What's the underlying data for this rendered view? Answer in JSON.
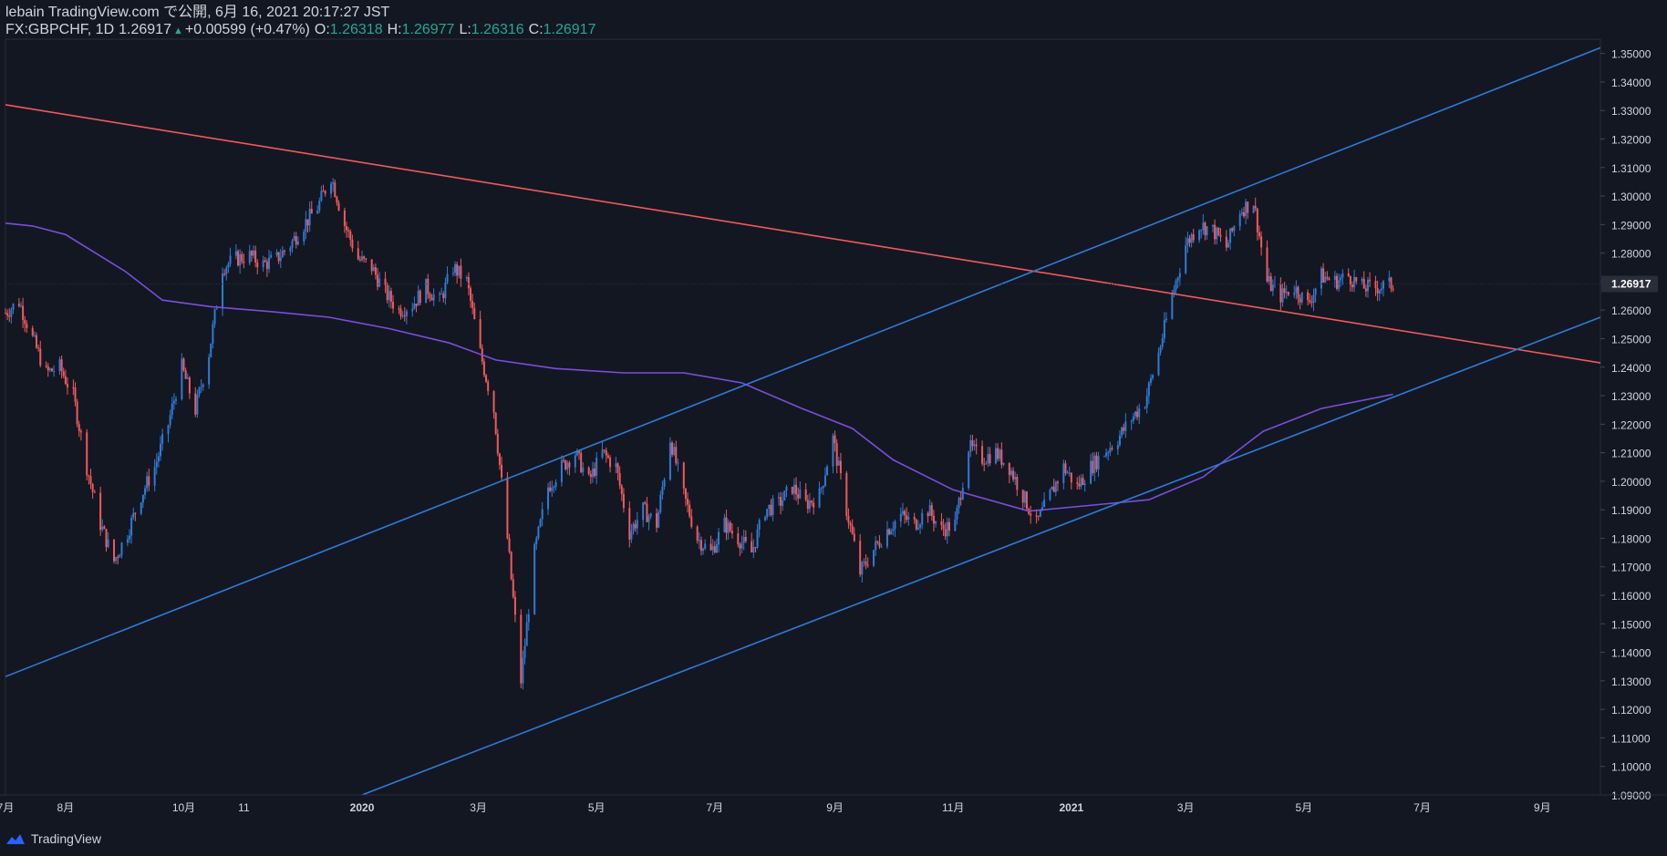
{
  "header": {
    "publish_line": "lebain TradingView.com で公開, 6月 16, 2021 20:17:27 JST",
    "symbol": "FX:GBPCHF, 1D",
    "last": "1.26917",
    "change": "+0.00599 (+0.47%)",
    "open_label": "O:",
    "open": "1.26318",
    "high_label": "H:",
    "high": "1.26977",
    "low_label": "L:",
    "low": "1.26316",
    "close_label": "C:",
    "close": "1.26917"
  },
  "footer": {
    "brand": "TradingView",
    "icon": "tradingview-logo-icon"
  },
  "colors": {
    "background": "#131722",
    "up": "#2e7bd6",
    "down": "#f05a5a",
    "trendline_red": "#f05a5a",
    "trendline_blue": "#2e7bd6",
    "moving_average": "#7c4ddb",
    "price_tag_bg": "#2a2e39",
    "text": "#d1d4dc"
  },
  "chart_data": {
    "type": "candlestick",
    "symbol": "FX:GBPCHF",
    "interval": "1D",
    "y_axis_side": "right",
    "ylim": [
      1.09,
      1.355
    ],
    "y_ticks": [
      "1.35000",
      "1.34000",
      "1.33000",
      "1.32000",
      "1.31000",
      "1.30000",
      "1.29000",
      "1.28000",
      "1.27000",
      "1.26000",
      "1.25000",
      "1.24000",
      "1.23000",
      "1.22000",
      "1.21000",
      "1.20000",
      "1.19000",
      "1.18000",
      "1.17000",
      "1.16000",
      "1.15000",
      "1.14000",
      "1.13000",
      "1.12000",
      "1.11000",
      "1.10000",
      "1.09000"
    ],
    "x_ticks": [
      {
        "label": "7月",
        "date": "2019-07-01"
      },
      {
        "label": "8月",
        "date": "2019-08-01"
      },
      {
        "label": "10月",
        "date": "2019-10-01"
      },
      {
        "label": "11",
        "date": "2019-11-01"
      },
      {
        "label": "2020",
        "date": "2020-01-01"
      },
      {
        "label": "3月",
        "date": "2020-03-01"
      },
      {
        "label": "5月",
        "date": "2020-05-01"
      },
      {
        "label": "7月",
        "date": "2020-07-01"
      },
      {
        "label": "9月",
        "date": "2020-09-01"
      },
      {
        "label": "11月",
        "date": "2020-11-01"
      },
      {
        "label": "2021",
        "date": "2021-01-01"
      },
      {
        "label": "3月",
        "date": "2021-03-01"
      },
      {
        "label": "5月",
        "date": "2021-05-01"
      },
      {
        "label": "7月",
        "date": "2021-07-01"
      },
      {
        "label": "9月",
        "date": "2021-09-01"
      }
    ],
    "x_range": [
      "2019-07-01",
      "2021-10-01"
    ],
    "last_price": "1.26917",
    "price_path": [
      [
        "2019-07-01",
        1.259
      ],
      [
        "2019-07-08",
        1.263
      ],
      [
        "2019-07-15",
        1.25
      ],
      [
        "2019-07-22",
        1.238
      ],
      [
        "2019-07-29",
        1.24
      ],
      [
        "2019-08-05",
        1.23
      ],
      [
        "2019-08-12",
        1.205
      ],
      [
        "2019-08-19",
        1.185
      ],
      [
        "2019-08-26",
        1.172
      ],
      [
        "2019-09-02",
        1.182
      ],
      [
        "2019-09-09",
        1.195
      ],
      [
        "2019-09-16",
        1.205
      ],
      [
        "2019-09-23",
        1.22
      ],
      [
        "2019-09-30",
        1.24
      ],
      [
        "2019-10-07",
        1.225
      ],
      [
        "2019-10-14",
        1.245
      ],
      [
        "2019-10-21",
        1.275
      ],
      [
        "2019-10-28",
        1.278
      ],
      [
        "2019-11-04",
        1.279
      ],
      [
        "2019-11-11",
        1.276
      ],
      [
        "2019-11-18",
        1.278
      ],
      [
        "2019-11-25",
        1.283
      ],
      [
        "2019-12-02",
        1.29
      ],
      [
        "2019-12-09",
        1.296
      ],
      [
        "2019-12-16",
        1.307
      ],
      [
        "2019-12-23",
        1.29
      ],
      [
        "2019-12-30",
        1.278
      ],
      [
        "2020-01-06",
        1.275
      ],
      [
        "2020-01-13",
        1.266
      ],
      [
        "2020-01-20",
        1.26
      ],
      [
        "2020-01-27",
        1.262
      ],
      [
        "2020-02-03",
        1.268
      ],
      [
        "2020-02-10",
        1.263
      ],
      [
        "2020-02-17",
        1.275
      ],
      [
        "2020-02-24",
        1.27
      ],
      [
        "2020-03-02",
        1.245
      ],
      [
        "2020-03-09",
        1.225
      ],
      [
        "2020-03-16",
        1.18
      ],
      [
        "2020-03-23",
        1.13
      ],
      [
        "2020-03-30",
        1.175
      ],
      [
        "2020-04-06",
        1.198
      ],
      [
        "2020-04-13",
        1.205
      ],
      [
        "2020-04-20",
        1.21
      ],
      [
        "2020-04-27",
        1.2
      ],
      [
        "2020-05-04",
        1.21
      ],
      [
        "2020-05-11",
        1.205
      ],
      [
        "2020-05-18",
        1.182
      ],
      [
        "2020-05-25",
        1.19
      ],
      [
        "2020-06-01",
        1.185
      ],
      [
        "2020-06-08",
        1.215
      ],
      [
        "2020-06-15",
        1.195
      ],
      [
        "2020-06-22",
        1.18
      ],
      [
        "2020-06-29",
        1.175
      ],
      [
        "2020-07-06",
        1.185
      ],
      [
        "2020-07-13",
        1.18
      ],
      [
        "2020-07-20",
        1.175
      ],
      [
        "2020-07-27",
        1.19
      ],
      [
        "2020-08-03",
        1.192
      ],
      [
        "2020-08-10",
        1.198
      ],
      [
        "2020-08-17",
        1.192
      ],
      [
        "2020-08-24",
        1.195
      ],
      [
        "2020-08-31",
        1.215
      ],
      [
        "2020-09-07",
        1.19
      ],
      [
        "2020-09-14",
        1.168
      ],
      [
        "2020-09-21",
        1.176
      ],
      [
        "2020-09-28",
        1.183
      ],
      [
        "2020-10-05",
        1.188
      ],
      [
        "2020-10-12",
        1.185
      ],
      [
        "2020-10-19",
        1.19
      ],
      [
        "2020-10-26",
        1.183
      ],
      [
        "2020-11-02",
        1.185
      ],
      [
        "2020-11-09",
        1.212
      ],
      [
        "2020-11-16",
        1.208
      ],
      [
        "2020-11-23",
        1.21
      ],
      [
        "2020-11-30",
        1.205
      ],
      [
        "2020-12-07",
        1.195
      ],
      [
        "2020-12-14",
        1.185
      ],
      [
        "2020-12-21",
        1.195
      ],
      [
        "2020-12-28",
        1.205
      ],
      [
        "2021-01-04",
        1.198
      ],
      [
        "2021-01-11",
        1.205
      ],
      [
        "2021-01-18",
        1.21
      ],
      [
        "2021-01-25",
        1.215
      ],
      [
        "2021-02-01",
        1.222
      ],
      [
        "2021-02-08",
        1.228
      ],
      [
        "2021-02-15",
        1.245
      ],
      [
        "2021-02-22",
        1.265
      ],
      [
        "2021-03-01",
        1.283
      ],
      [
        "2021-03-08",
        1.29
      ],
      [
        "2021-03-15",
        1.288
      ],
      [
        "2021-03-22",
        1.282
      ],
      [
        "2021-03-29",
        1.295
      ],
      [
        "2021-04-05",
        1.298
      ],
      [
        "2021-04-12",
        1.27
      ],
      [
        "2021-04-19",
        1.265
      ],
      [
        "2021-04-26",
        1.268
      ],
      [
        "2021-05-03",
        1.262
      ],
      [
        "2021-05-10",
        1.272
      ],
      [
        "2021-05-17",
        1.27
      ],
      [
        "2021-05-24",
        1.272
      ],
      [
        "2021-05-31",
        1.268
      ],
      [
        "2021-06-07",
        1.268
      ],
      [
        "2021-06-16",
        1.269
      ]
    ],
    "series": [
      {
        "type": "moving-average",
        "points": [
          [
            "2019-07-01",
            1.2905
          ],
          [
            "2019-07-15",
            1.2895
          ],
          [
            "2019-08-01",
            1.2865
          ],
          [
            "2019-09-01",
            1.2735
          ],
          [
            "2019-09-20",
            1.2635
          ],
          [
            "2019-10-15",
            1.2612
          ],
          [
            "2019-11-15",
            1.2595
          ],
          [
            "2019-12-15",
            1.2575
          ],
          [
            "2020-01-15",
            1.2535
          ],
          [
            "2020-02-15",
            1.2485
          ],
          [
            "2020-03-10",
            1.2425
          ],
          [
            "2020-04-10",
            1.2395
          ],
          [
            "2020-05-15",
            1.238
          ],
          [
            "2020-06-15",
            1.238
          ],
          [
            "2020-07-15",
            1.2345
          ],
          [
            "2020-08-15",
            1.2255
          ],
          [
            "2020-09-10",
            1.2185
          ],
          [
            "2020-10-01",
            1.2075
          ],
          [
            "2020-11-01",
            1.197
          ],
          [
            "2020-12-10",
            1.1895
          ],
          [
            "2021-01-10",
            1.1915
          ],
          [
            "2021-02-10",
            1.1935
          ],
          [
            "2021-03-10",
            1.2015
          ],
          [
            "2021-04-10",
            1.2175
          ],
          [
            "2021-05-10",
            1.2255
          ],
          [
            "2021-06-16",
            1.2305
          ]
        ]
      }
    ],
    "trendlines": [
      {
        "color": "red",
        "points": [
          [
            "2019-07-01",
            1.332
          ],
          [
            "2021-10-01",
            1.2415
          ]
        ]
      },
      {
        "color": "blue",
        "points": [
          [
            "2019-07-01",
            1.1315
          ],
          [
            "2021-10-01",
            1.352
          ]
        ]
      },
      {
        "color": "blue",
        "points": [
          [
            "2020-01-01",
            1.09
          ],
          [
            "2021-10-01",
            1.2575
          ]
        ]
      }
    ]
  }
}
